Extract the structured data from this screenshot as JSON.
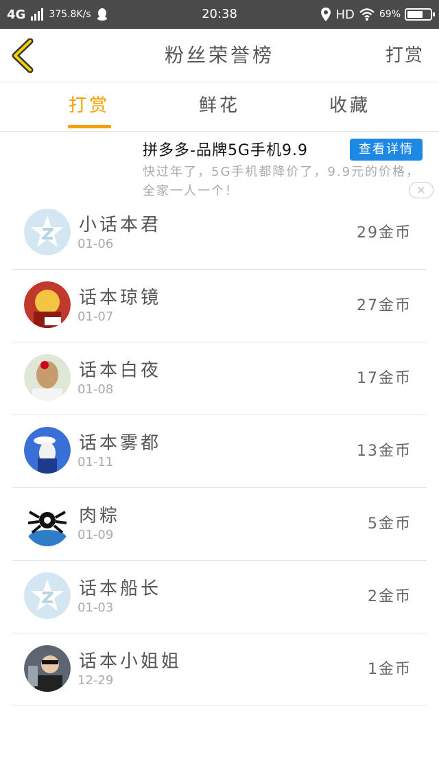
{
  "status_bar": {
    "network": "4G",
    "speed": "375.8K/s",
    "time": "20:38",
    "hd": "HD",
    "battery": "69%",
    "battery_level": 0.69
  },
  "header": {
    "title": "粉丝荣誉榜",
    "right_action": "打赏"
  },
  "tabs": [
    {
      "label": "打赏",
      "active": true
    },
    {
      "label": "鲜花",
      "active": false
    },
    {
      "label": "收藏",
      "active": false
    }
  ],
  "ad": {
    "title": "拼多多-品牌5G手机9.9",
    "button": "查看详情",
    "description": "快过年了，5G手机都降价了，9.9元的价格，全家一人一个！",
    "close": "×"
  },
  "colors": {
    "accent": "#f5a000",
    "ad_button": "#1e88e5",
    "status_bar": "#4a4a4a"
  },
  "list": [
    {
      "name": "小话本君",
      "date": "01-06",
      "coins": "29金币",
      "avatar": "default-star-avatar"
    },
    {
      "name": "话本琼镜",
      "date": "01-07",
      "coins": "27金币",
      "avatar": "user-avatar"
    },
    {
      "name": "话本白夜",
      "date": "01-08",
      "coins": "17金币",
      "avatar": "user-avatar"
    },
    {
      "name": "话本雾都",
      "date": "01-11",
      "coins": "13金币",
      "avatar": "user-avatar"
    },
    {
      "name": "肉粽",
      "date": "01-09",
      "coins": "5金币",
      "avatar": "user-avatar"
    },
    {
      "name": "话本船长",
      "date": "01-03",
      "coins": "2金币",
      "avatar": "default-star-avatar"
    },
    {
      "name": "话本小姐姐",
      "date": "12-29",
      "coins": "1金币",
      "avatar": "user-avatar"
    }
  ]
}
